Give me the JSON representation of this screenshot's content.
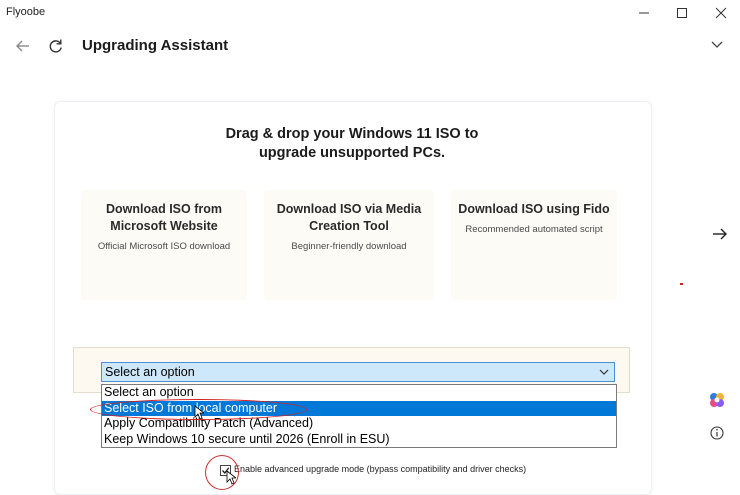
{
  "window": {
    "app_name": "Flyoobe",
    "controls": {
      "minimize_icon": "minimize-icon",
      "maximize_icon": "maximize-icon",
      "close_icon": "close-icon"
    }
  },
  "header": {
    "title": "Upgrading Assistant",
    "back_icon": "back-arrow-icon",
    "refresh_icon": "refresh-icon",
    "expand_icon": "chevron-down-icon"
  },
  "main": {
    "heading_line1": "Drag & drop your Windows 11 ISO to",
    "heading_line2": "upgrade unsupported PCs.",
    "options": [
      {
        "title": "Download ISO from Microsoft Website",
        "subtitle": "Official Microsoft ISO download"
      },
      {
        "title": "Download ISO via Media Creation Tool",
        "subtitle": "Beginner-friendly download"
      },
      {
        "title": "Download ISO using Fido",
        "subtitle": "Recommended automated script"
      }
    ],
    "select": {
      "value": "Select an option",
      "options": [
        "Select an option",
        "Select ISO from local computer",
        "Apply Compatibility Patch (Advanced)",
        "Keep Windows 10 secure until 2026 (Enroll in ESU)"
      ],
      "highlighted_index": 1
    },
    "advanced_mode": {
      "label": "Enable advanced upgrade mode (bypass compatibility and driver checks)",
      "checked": true
    }
  },
  "sidebar_right": {
    "next_icon": "arrow-right-icon",
    "copilot_icon": "copilot-icon",
    "info_icon": "info-icon"
  },
  "colors": {
    "selection": "#0078d7",
    "select_bg": "#cde8fb",
    "annotation": "#d02020",
    "card_bg": "#fdfbf6"
  }
}
